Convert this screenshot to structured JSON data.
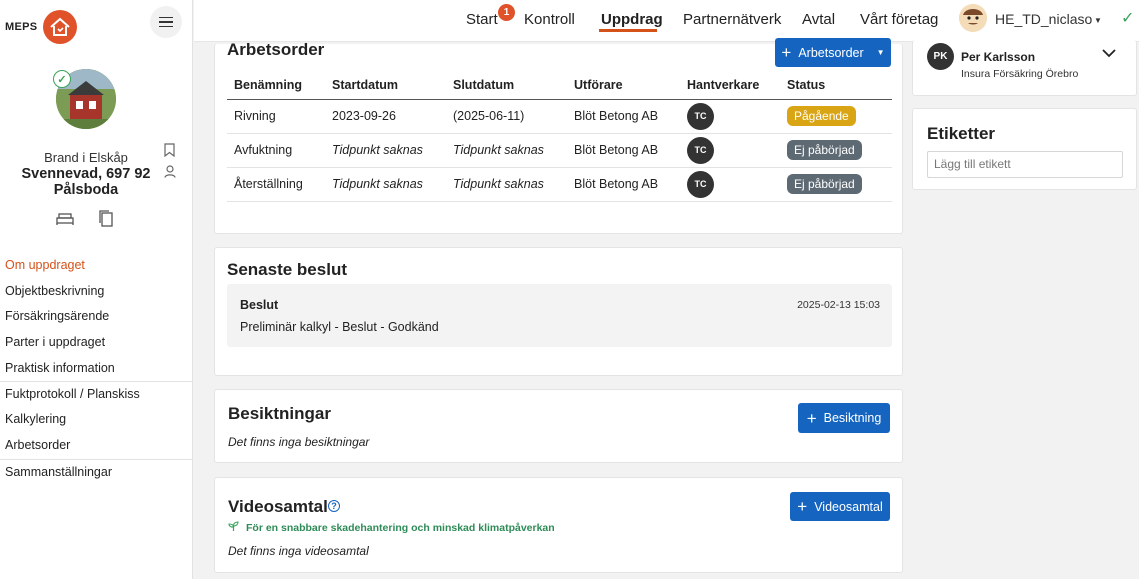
{
  "sidebar": {
    "logo_text": "MEPS",
    "property_sub": "Brand i Elskåp",
    "property_name_line1": "Svennevad, 697 92",
    "property_name_line2": "Pålsboda",
    "nav": [
      {
        "label": "Om uppdraget"
      },
      {
        "label": "Objektbeskrivning"
      },
      {
        "label": "Försäkringsärende"
      },
      {
        "label": "Parter i uppdraget"
      },
      {
        "label": "Praktisk information"
      },
      {
        "label": "Fuktprotokoll / Planskiss"
      },
      {
        "label": "Kalkylering"
      },
      {
        "label": "Arbetsorder"
      },
      {
        "label": "Sammanställningar"
      }
    ]
  },
  "topnav": {
    "items": [
      {
        "label": "Start"
      },
      {
        "label": "Kontroll"
      },
      {
        "label": "Uppdrag"
      },
      {
        "label": "Partnernätverk"
      },
      {
        "label": "Avtal"
      },
      {
        "label": "Vårt företag"
      }
    ],
    "start_badge": "1",
    "active": "Uppdrag",
    "user_name": "HE_TD_niclaso"
  },
  "arbetsorder": {
    "title": "Arbetsorder",
    "button_label": "Arbetsorder",
    "columns": [
      "Benämning",
      "Startdatum",
      "Slutdatum",
      "Utförare",
      "Hantverkare",
      "Status"
    ],
    "rows": [
      {
        "name": "Rivning",
        "start": "2023-09-26",
        "end": "(2025-06-11)",
        "performer": "Blöt Betong AB",
        "craftsman": "TC",
        "status": "Pågående"
      },
      {
        "name": "Avfuktning",
        "start": "Tidpunkt saknas",
        "end": "Tidpunkt saknas",
        "performer": "Blöt Betong AB",
        "craftsman": "TC",
        "status": "Ej påbörjad"
      },
      {
        "name": "Återställning",
        "start": "Tidpunkt saknas",
        "end": "Tidpunkt saknas",
        "performer": "Blöt Betong AB",
        "craftsman": "TC",
        "status": "Ej påbörjad"
      }
    ]
  },
  "beslut": {
    "title": "Senaste beslut",
    "label": "Beslut",
    "timestamp": "2025-02-13 15:03",
    "text": "Preliminär kalkyl - Beslut - Godkänd"
  },
  "besiktningar": {
    "title": "Besiktningar",
    "button_label": "Besiktning",
    "empty": "Det finns inga besiktningar"
  },
  "videosamtal": {
    "title": "Videosamtal",
    "info": "För en snabbare skadehantering och minskad klimatpåverkan",
    "button_label": "Videosamtal",
    "empty": "Det finns inga videosamtal"
  },
  "contact": {
    "initials": "PK",
    "name": "Per Karlsson",
    "company": "Insura Försäkring Örebro"
  },
  "etiketter": {
    "title": "Etiketter",
    "placeholder": "Lägg till etikett"
  },
  "colors": {
    "brand": "#e0522a",
    "primary": "#1565c0",
    "status_ongoing": "#d9a514",
    "status_not_started": "#5e6a73",
    "success": "#3aa35b"
  }
}
